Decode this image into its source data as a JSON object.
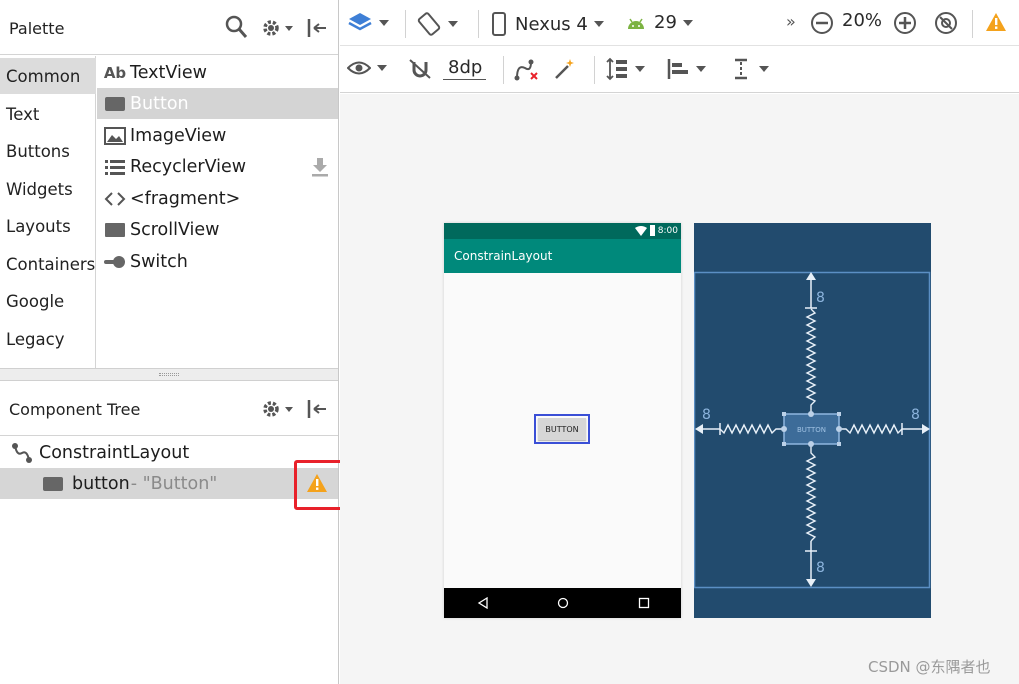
{
  "palette": {
    "title": "Palette",
    "categories": [
      {
        "label": "Common",
        "selected": true
      },
      {
        "label": "Text",
        "selected": false
      },
      {
        "label": "Buttons",
        "selected": false
      },
      {
        "label": "Widgets",
        "selected": false
      },
      {
        "label": "Layouts",
        "selected": false
      },
      {
        "label": "Containers",
        "selected": false
      },
      {
        "label": "Google",
        "selected": false
      },
      {
        "label": "Legacy",
        "selected": false
      }
    ],
    "widgets": [
      {
        "label": "TextView",
        "icon": "ab-textview-icon"
      },
      {
        "label": "Button",
        "icon": "button-icon",
        "selected": true
      },
      {
        "label": "ImageView",
        "icon": "image-icon"
      },
      {
        "label": "RecyclerView",
        "icon": "list-icon"
      },
      {
        "label": "<fragment>",
        "icon": "code-brackets-icon"
      },
      {
        "label": "ScrollView",
        "icon": "scrollview-icon"
      },
      {
        "label": "Switch",
        "icon": "switch-icon"
      }
    ],
    "textview_icon_text": "Ab"
  },
  "component_tree": {
    "title": "Component Tree",
    "root_label": "ConstraintLayout",
    "child_id": "button",
    "child_text": "- \"Button\""
  },
  "toolbar": {
    "device": "Nexus 4",
    "api_level": "29",
    "overflow": "»",
    "zoom": "20%",
    "margin": "8dp"
  },
  "phone": {
    "status_time": "8:00",
    "app_title": "ConstrainLayout",
    "button_text": "BUTTON"
  },
  "blueprint": {
    "button_text": "BUTTON",
    "margins": {
      "top": "8",
      "left": "8",
      "right": "8",
      "bottom": "8"
    }
  },
  "colors": {
    "accent": "#3e7fd6",
    "warning": "#f4a21c",
    "highlight": "#e8212a",
    "phone_appbar": "#00897b",
    "phone_statusbar": "#00695c",
    "blueprint_bg": "#224b6e",
    "blueprint_line": "#d8e6f5"
  },
  "watermark": "CSDN @东隅者也"
}
